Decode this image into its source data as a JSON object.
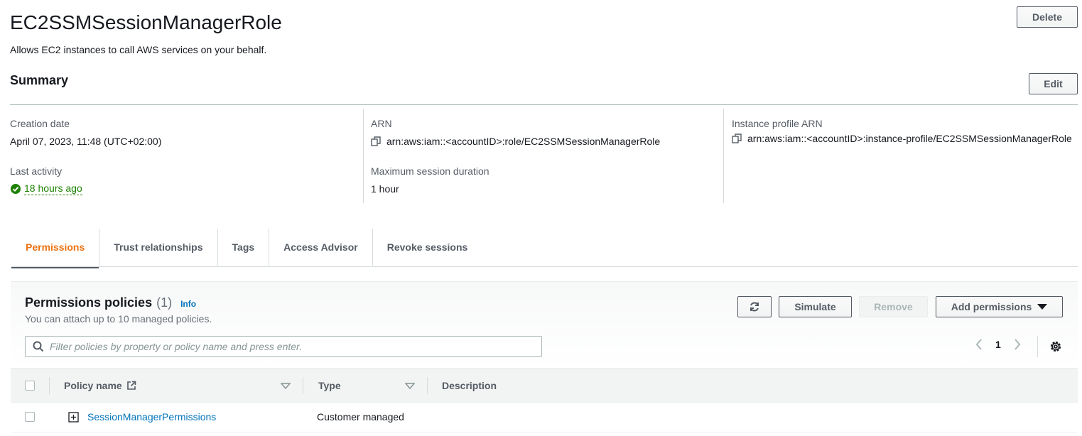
{
  "role": {
    "name": "EC2SSMSessionManagerRole",
    "description": "Allows EC2 instances to call AWS services on your behalf."
  },
  "actions": {
    "delete_label": "Delete",
    "edit_label": "Edit"
  },
  "summary": {
    "heading": "Summary",
    "creation_date_label": "Creation date",
    "creation_date_value": "April 07, 2023, 11:48 (UTC+02:00)",
    "last_activity_label": "Last activity",
    "last_activity_value": "18 hours ago",
    "arn_label": "ARN",
    "arn_value": "arn:aws:iam::<accountID>:role/EC2SSMSessionManagerRole",
    "max_session_label": "Maximum session duration",
    "max_session_value": "1 hour",
    "instance_profile_label": "Instance profile ARN",
    "instance_profile_value": "arn:aws:iam::<accountID>:instance-profile/EC2SSMSessionManagerRole"
  },
  "tabs": [
    {
      "label": "Permissions",
      "active": true
    },
    {
      "label": "Trust relationships",
      "active": false
    },
    {
      "label": "Tags",
      "active": false
    },
    {
      "label": "Access Advisor",
      "active": false
    },
    {
      "label": "Revoke sessions",
      "active": false
    }
  ],
  "permissions": {
    "title": "Permissions policies",
    "count": "(1)",
    "info_label": "Info",
    "subtitle": "You can attach up to 10 managed policies.",
    "simulate_label": "Simulate",
    "remove_label": "Remove",
    "add_permissions_label": "Add permissions",
    "filter_placeholder": "Filter policies by property or policy name and press enter.",
    "page_number": "1",
    "columns": {
      "policy_name": "Policy name",
      "type": "Type",
      "description": "Description"
    },
    "rows": [
      {
        "policy_name": "SessionManagerPermissions",
        "type": "Customer managed",
        "description": ""
      }
    ]
  },
  "colors": {
    "accent_orange": "#ec7211",
    "link_blue": "#0073bb",
    "success_green": "#1d8102"
  }
}
